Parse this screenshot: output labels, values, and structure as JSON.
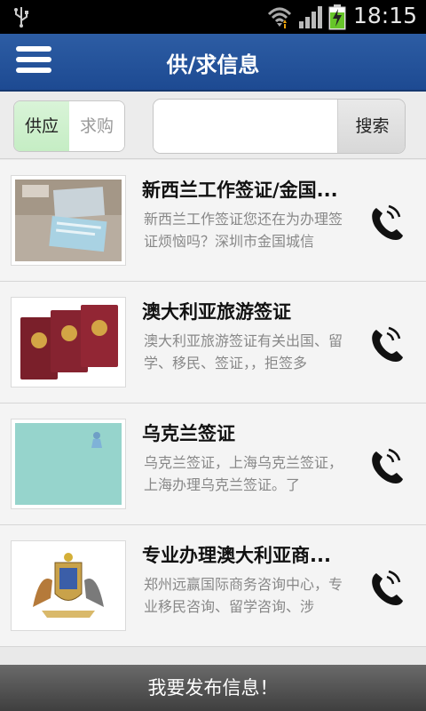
{
  "status_bar": {
    "time": "18:15"
  },
  "header": {
    "title": "供/求信息"
  },
  "toolbar": {
    "segment": {
      "supply_label": "供应",
      "demand_label": "求购"
    },
    "search": {
      "placeholder": "",
      "button_label": "搜索"
    }
  },
  "listings": [
    {
      "title": "新西兰工作签证/金国...",
      "description": "新西兰工作签证您还在为办理签证烦恼吗？深圳市金国城信"
    },
    {
      "title": "澳大利亚旅游签证",
      "description": "澳大利亚旅游签证有关出国、留学、移民、签证，，拒签多"
    },
    {
      "title": "乌克兰签证",
      "description": "乌克兰签证，上海乌克兰签证，上海办理乌克兰签证。了"
    },
    {
      "title": "专业办理澳大利亚商...",
      "description": "郑州远赢国际商务咨询中心，专业移民咨询、留学咨询、涉"
    }
  ],
  "bottom_bar": {
    "label": "我要发布信息！"
  },
  "colors": {
    "header": "#2d5da4",
    "segment_active": "#c5edc4",
    "bottom_bar": "#4a4a4a"
  }
}
